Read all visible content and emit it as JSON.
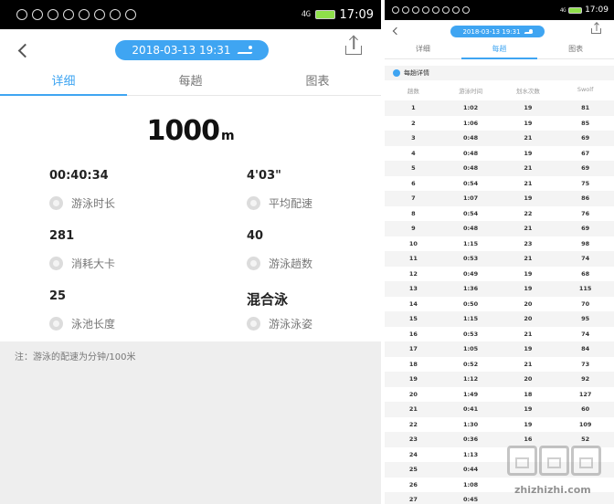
{
  "left": {
    "status": {
      "time": "17:09",
      "network": "4G"
    },
    "header": {
      "datetime": "2018-03-13 19:31"
    },
    "tabs": [
      "详细",
      "每趟",
      "图表"
    ],
    "distance": {
      "value": "1000",
      "unit": "m"
    },
    "stats": [
      {
        "value": "00:40:34",
        "label": "游泳时长",
        "icon": "clock-icon"
      },
      {
        "value": "4'03\"",
        "label": "平均配速",
        "icon": "pace-icon"
      },
      {
        "value": "281",
        "label": "消耗大卡",
        "icon": "flame-icon"
      },
      {
        "value": "40",
        "label": "游泳趟数",
        "icon": "laps-icon"
      },
      {
        "value": "25",
        "label": "泳池长度",
        "icon": "pool-icon"
      },
      {
        "value": "混合泳",
        "label": "游泳泳姿",
        "icon": "stroke-icon"
      }
    ],
    "note": "注：游泳的配速为分钟/100米"
  },
  "right": {
    "status": {
      "time": "17:09",
      "network": "4G"
    },
    "header": {
      "datetime": "2018-03-13 19:31"
    },
    "tabs": [
      "详细",
      "每趟",
      "图表"
    ],
    "section_title": "每趟详情",
    "columns": [
      "趟数",
      "游泳时间",
      "划水次数",
      "Swolf"
    ],
    "rows": [
      [
        "1",
        "1:02",
        "19",
        "81"
      ],
      [
        "2",
        "1:06",
        "19",
        "85"
      ],
      [
        "3",
        "0:48",
        "21",
        "69"
      ],
      [
        "4",
        "0:48",
        "19",
        "67"
      ],
      [
        "5",
        "0:48",
        "21",
        "69"
      ],
      [
        "6",
        "0:54",
        "21",
        "75"
      ],
      [
        "7",
        "1:07",
        "19",
        "86"
      ],
      [
        "8",
        "0:54",
        "22",
        "76"
      ],
      [
        "9",
        "0:48",
        "21",
        "69"
      ],
      [
        "10",
        "1:15",
        "23",
        "98"
      ],
      [
        "11",
        "0:53",
        "21",
        "74"
      ],
      [
        "12",
        "0:49",
        "19",
        "68"
      ],
      [
        "13",
        "1:36",
        "19",
        "115"
      ],
      [
        "14",
        "0:50",
        "20",
        "70"
      ],
      [
        "15",
        "1:15",
        "20",
        "95"
      ],
      [
        "16",
        "0:53",
        "21",
        "74"
      ],
      [
        "17",
        "1:05",
        "19",
        "84"
      ],
      [
        "18",
        "0:52",
        "21",
        "73"
      ],
      [
        "19",
        "1:12",
        "20",
        "92"
      ],
      [
        "20",
        "1:49",
        "18",
        "127"
      ],
      [
        "21",
        "0:41",
        "19",
        "60"
      ],
      [
        "22",
        "1:30",
        "19",
        "109"
      ],
      [
        "23",
        "0:36",
        "16",
        "52"
      ],
      [
        "24",
        "1:13",
        "",
        ""
      ],
      [
        "25",
        "0:44",
        "",
        ""
      ],
      [
        "26",
        "1:08",
        "",
        ""
      ],
      [
        "27",
        "0:45",
        "",
        ""
      ]
    ]
  },
  "watermark": "zhizhizhi.com",
  "colors": {
    "accent": "#3fa5f2",
    "statusbar": "#000000",
    "note_bg": "#eeeeee"
  }
}
